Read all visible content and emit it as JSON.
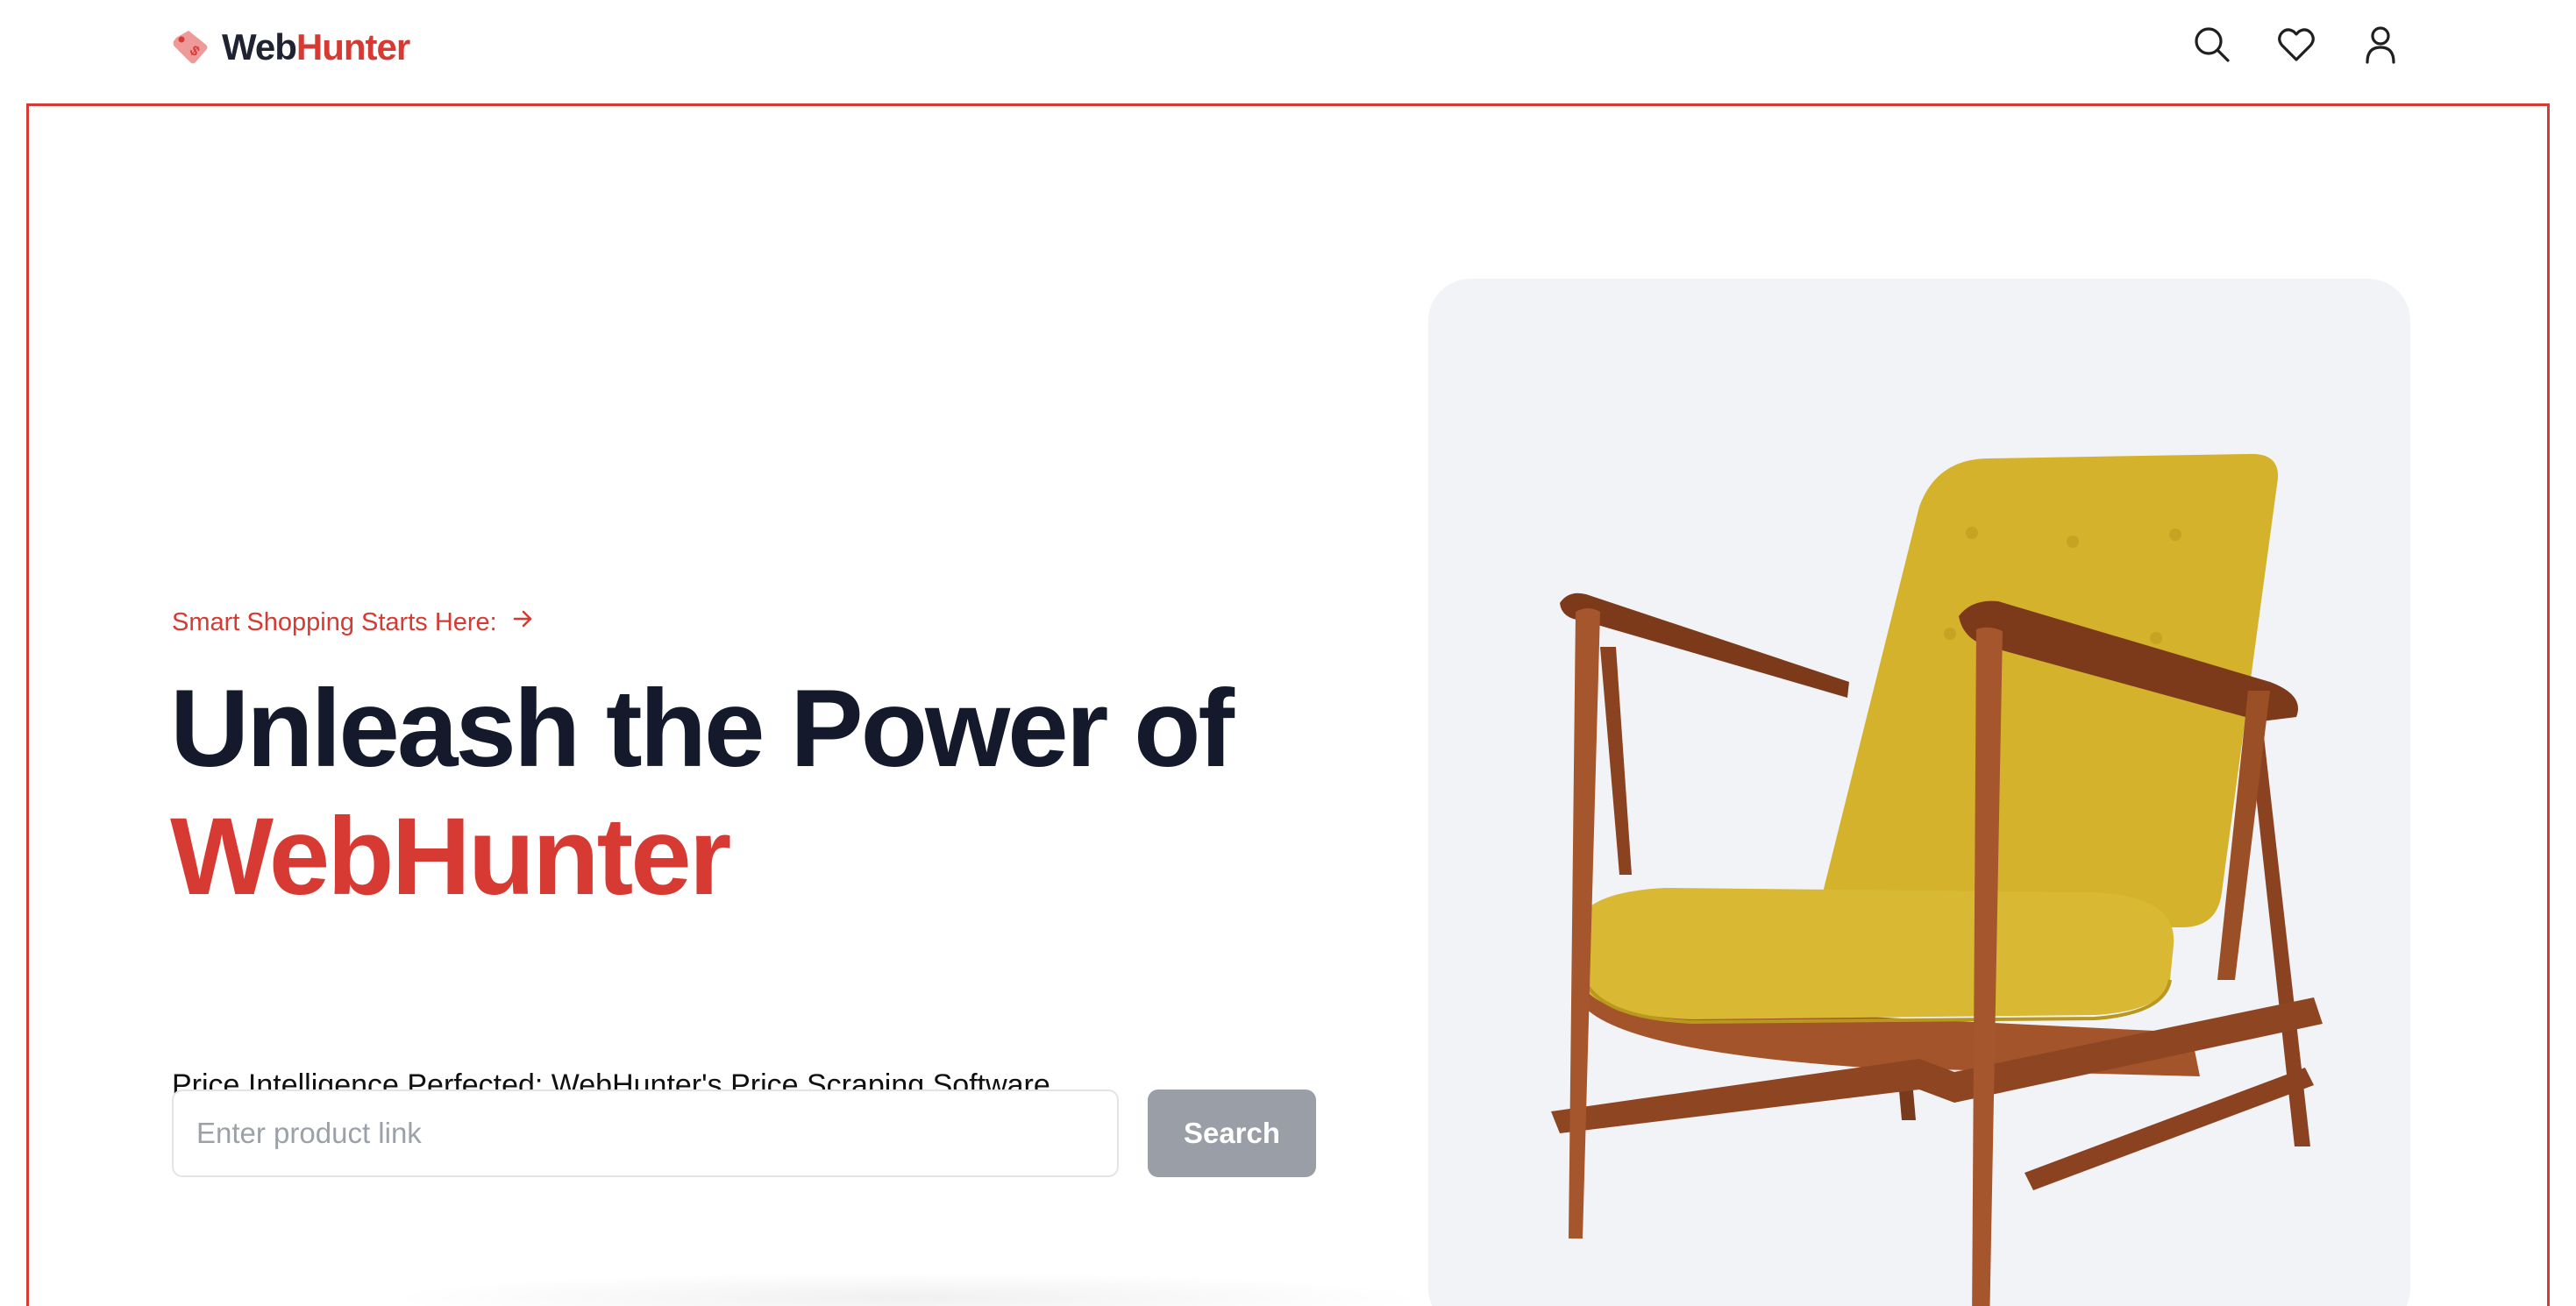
{
  "brand": {
    "name_part1": "Web",
    "name_part2": "Hunter",
    "accent_color": "#d63a33",
    "logo_icon": "price-tag-icon"
  },
  "nav": {
    "icons": [
      "search-icon",
      "heart-icon",
      "user-icon"
    ]
  },
  "hero": {
    "tagline": "Smart Shopping Starts Here:",
    "tagline_icon": "arrow-right-icon",
    "headline_line1": "Unleash the Power of",
    "headline_line2": "WebHunter",
    "subheading": "Price Intelligence Perfected: WebHunter's Price Scraping Software",
    "search": {
      "placeholder": "Enter product link",
      "value": "",
      "button_label": "Search"
    },
    "image": "yellow-armchair"
  },
  "colors": {
    "text_dark": "#141a2b",
    "button_disabled": "#9a9ea6",
    "panel_bg": "#f2f3f7",
    "chair_fabric": "#d4b22c",
    "chair_wood": "#a3542a"
  }
}
